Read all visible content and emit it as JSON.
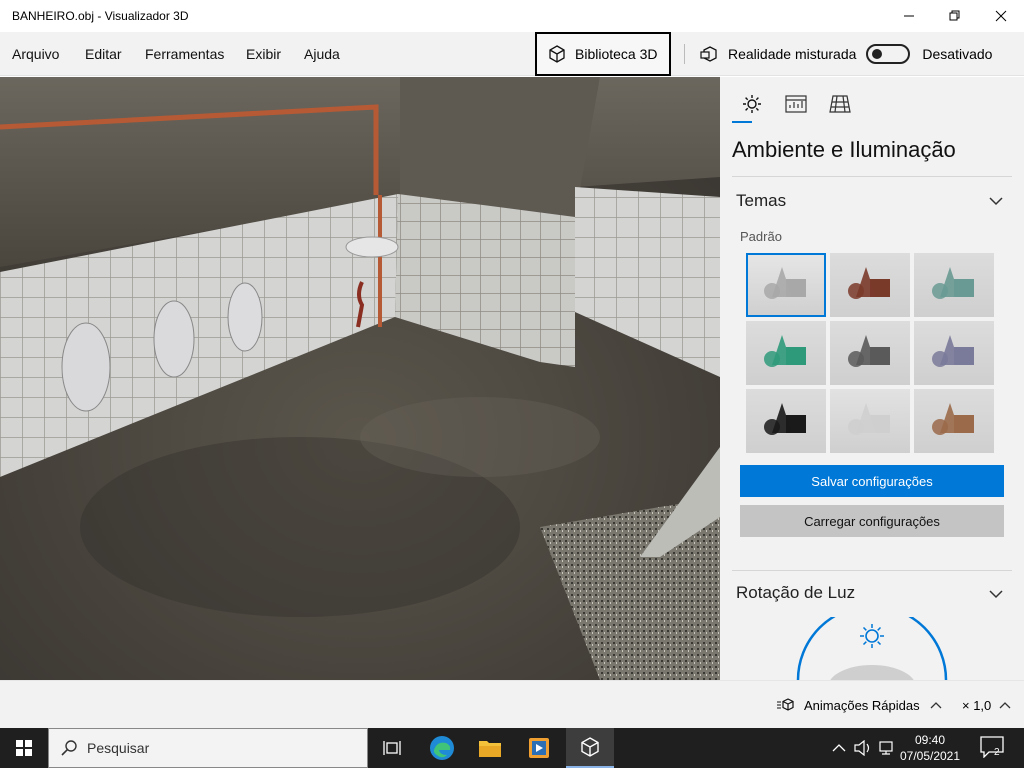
{
  "window": {
    "title": "BANHEIRO.obj - Visualizador 3D"
  },
  "menu": {
    "items": [
      "Arquivo",
      "Editar",
      "Ferramentas",
      "Exibir",
      "Ajuda"
    ],
    "library_button": "Biblioteca 3D",
    "mixed_reality_label": "Realidade misturada",
    "mixed_reality_state": "Desativado"
  },
  "panel": {
    "title": "Ambiente e Iluminação",
    "themes_header": "Temas",
    "themes_sublabel": "Padrão",
    "save_button": "Salvar configurações",
    "load_button": "Carregar configurações",
    "light_rotation_header": "Rotação de Luz",
    "theme_tiles": [
      {
        "bg": "#e6e6e6",
        "shape": "#a8a8a8",
        "selected": true
      },
      {
        "bg": "#dcdcdc",
        "shape": "#7a3a2a",
        "selected": false
      },
      {
        "bg": "#dcdcdc",
        "shape": "#6a9a94",
        "selected": false
      },
      {
        "bg": "#dcdcdc",
        "shape": "#2f9a7a",
        "selected": false
      },
      {
        "bg": "#dcdcdc",
        "shape": "#5a5a5a",
        "selected": false
      },
      {
        "bg": "#dcdcdc",
        "shape": "#7a7a9a",
        "selected": false
      },
      {
        "bg": "#dcdcdc",
        "shape": "#1a1a1a",
        "selected": false
      },
      {
        "bg": "#e2e2e2",
        "shape": "#cfcfcf",
        "selected": false
      },
      {
        "bg": "#dcdcdc",
        "shape": "#9a6a4a",
        "selected": false
      }
    ]
  },
  "status": {
    "animations_label": "Animações Rápidas",
    "speed_label": "× 1,0"
  },
  "taskbar": {
    "search_placeholder": "Pesquisar",
    "time": "09:40",
    "date": "07/05/2021",
    "notifications": "2"
  },
  "colors": {
    "accent": "#0078d7",
    "taskbar": "#1f1f1f"
  }
}
